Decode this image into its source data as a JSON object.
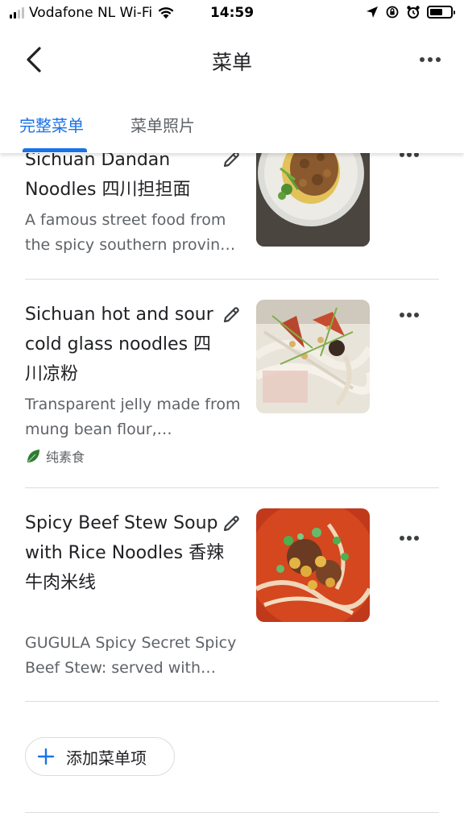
{
  "status_bar": {
    "carrier": "Vodafone NL Wi-Fi",
    "time": "14:59"
  },
  "header": {
    "title": "菜单"
  },
  "tabs": [
    {
      "label": "完整菜单",
      "active": true
    },
    {
      "label": "菜单照片",
      "active": false
    }
  ],
  "menu_items": [
    {
      "name": "Sichuan Dandan Noodles 四川担担面",
      "description": "A famous street food from the spicy southern provin…",
      "tag": null
    },
    {
      "name": "Sichuan hot and sour cold glass noodles 四川凉粉",
      "description": "Transparent jelly made from mung bean flour,…",
      "tag": "纯素食"
    },
    {
      "name": "Spicy Beef Stew Soup with Rice Noodles 香辣牛肉米线",
      "description": "GUGULA Spicy Secret Spicy Beef Stew: served with…",
      "tag": null
    }
  ],
  "add_item": {
    "label": "添加菜单项"
  },
  "colors": {
    "accent": "#1a73e8",
    "divider": "#dadce0",
    "secondary_text": "#5f6368",
    "vegan_leaf": "#2e7d32"
  },
  "icons": {
    "back": "chevron-left-icon",
    "more": "more-horizontal-icon",
    "edit": "pencil-icon",
    "add": "plus-icon",
    "vegan": "leaf-icon"
  }
}
